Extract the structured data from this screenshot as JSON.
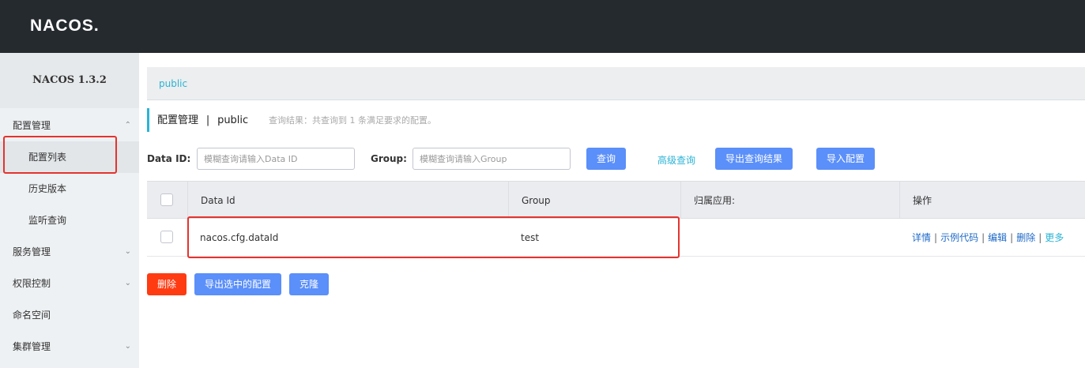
{
  "header": {
    "logo": "NACOS",
    "logo_dot": "."
  },
  "sidebar": {
    "version": "NACOS 1.3.2",
    "items": [
      {
        "label": "配置管理",
        "chevron": "^"
      },
      {
        "label": "配置列表"
      },
      {
        "label": "历史版本"
      },
      {
        "label": "监听查询"
      },
      {
        "label": "服务管理",
        "chevron": "v"
      },
      {
        "label": "权限控制",
        "chevron": "v"
      },
      {
        "label": "命名空间"
      },
      {
        "label": "集群管理",
        "chevron": "v"
      }
    ]
  },
  "namespace": {
    "current": "public"
  },
  "title": {
    "main": "配置管理",
    "separator": "|",
    "namespace": "public",
    "summary": "查询结果：共查询到 1 条满足要求的配置。"
  },
  "search": {
    "data_id_label": "Data ID:",
    "data_id_placeholder": "模糊查询请输入Data ID",
    "group_label": "Group:",
    "group_placeholder": "模糊查询请输入Group",
    "query_button": "查询",
    "advanced_link": "高级查询",
    "export_button": "导出查询结果",
    "import_button": "导入配置"
  },
  "table": {
    "columns": [
      "Data Id",
      "Group",
      "归属应用:",
      "操作"
    ],
    "rows": [
      {
        "data_id": "nacos.cfg.dataId",
        "group": "test",
        "app": ""
      }
    ],
    "ops": {
      "detail": "详情",
      "sample": "示例代码",
      "edit": "编辑",
      "delete": "删除",
      "more": "更多",
      "sep": "|"
    }
  },
  "bottom": {
    "delete_button": "删除",
    "export_selected_button": "导出选中的配置",
    "clone_button": "克隆"
  },
  "colors": {
    "header_bg": "#252a2f",
    "sidebar_bg": "#eef1f3",
    "primary_blue": "#5b8ff9",
    "danger_red": "#ff3b12",
    "link_cyan": "#2bb3d5",
    "highlight_red": "#e5332e"
  }
}
